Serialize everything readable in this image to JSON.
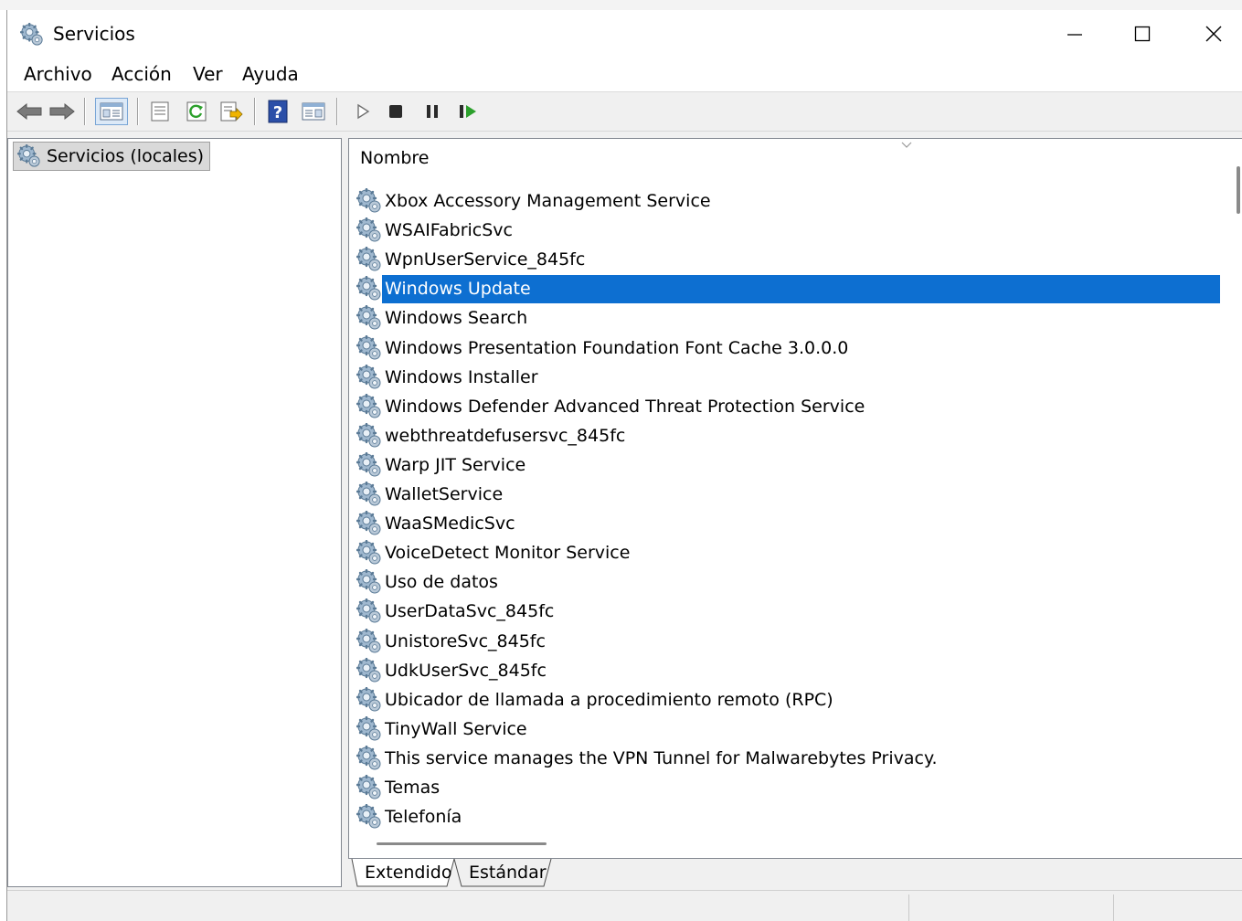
{
  "window": {
    "title": "Servicios"
  },
  "menu": {
    "items": [
      "Archivo",
      "Acción",
      "Ver",
      "Ayuda"
    ]
  },
  "toolbar": {
    "buttons": [
      "back-arrow-icon",
      "forward-arrow-icon",
      "console-tree-icon",
      "properties-icon",
      "refresh-icon",
      "export-list-icon",
      "help-icon",
      "action-pane-icon",
      "play-icon",
      "stop-icon",
      "pause-icon",
      "resume-icon"
    ]
  },
  "tree": {
    "root_label": "Servicios (locales)"
  },
  "list": {
    "column_header": "Nombre",
    "selected_index": 3,
    "items": [
      "Xbox Accessory Management Service",
      "WSAIFabricSvc",
      "WpnUserService_845fc",
      "Windows Update",
      "Windows Search",
      "Windows Presentation Foundation Font Cache 3.0.0.0",
      "Windows Installer",
      "Windows Defender Advanced Threat Protection Service",
      "webthreatdefusersvc_845fc",
      "Warp JIT Service",
      "WalletService",
      "WaaSMedicSvc",
      "VoiceDetect Monitor Service",
      "Uso de datos",
      "UserDataSvc_845fc",
      "UnistoreSvc_845fc",
      "UdkUserSvc_845fc",
      "Ubicador de llamada a procedimiento remoto (RPC)",
      "TinyWall Service",
      "This service manages the VPN Tunnel for Malwarebytes Privacy.",
      "Temas",
      "Telefonía"
    ]
  },
  "tabs": {
    "extended": "Extendido",
    "standard": "Estándar"
  },
  "colors": {
    "selection": "#0d6fd1",
    "play_green": "#2ca02c"
  }
}
